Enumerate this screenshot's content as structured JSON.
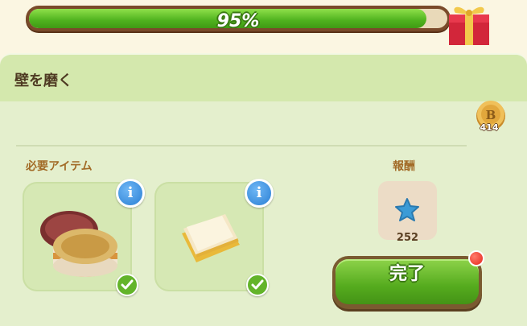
{
  "progress": {
    "percent": 95,
    "label": "95%"
  },
  "task": {
    "title": "壁を磨く"
  },
  "coins": {
    "count": "414",
    "icon": "coin-b-icon"
  },
  "required": {
    "label": "必要アイテム",
    "items": [
      {
        "name": "cream-jar",
        "icon": "cream-jar-icon",
        "checked": true
      },
      {
        "name": "cloth",
        "icon": "cloth-icon",
        "checked": true
      }
    ]
  },
  "reward": {
    "label": "報酬",
    "count": "252",
    "icon": "blue-star-icon"
  },
  "complete_button": {
    "label": "完了",
    "has_notification": true
  },
  "colors": {
    "accent_green": "#55ab1e",
    "info_blue": "#2a7fd4",
    "notif_red": "#e5271d"
  }
}
